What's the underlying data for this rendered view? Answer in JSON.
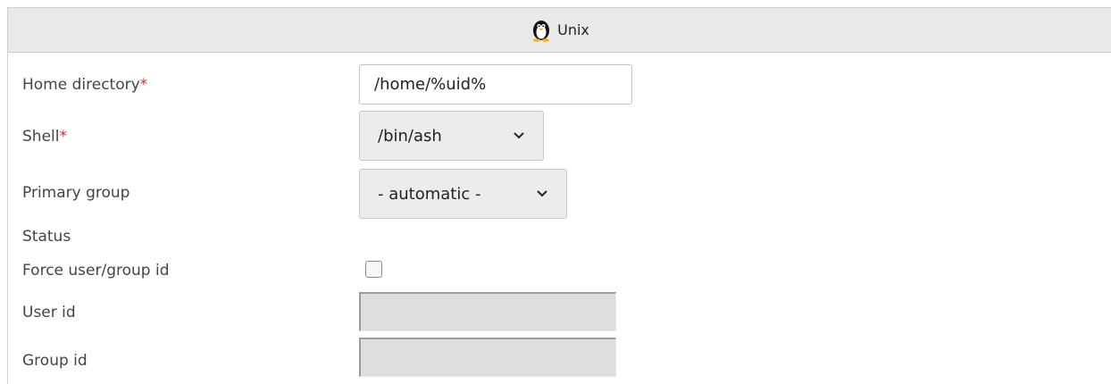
{
  "panel": {
    "title": "Unix",
    "icon": "tux-penguin-icon"
  },
  "fields": {
    "home_directory": {
      "label": "Home directory",
      "required_mark": "*",
      "value": "/home/%uid%"
    },
    "shell": {
      "label": "Shell",
      "required_mark": "*",
      "value": "/bin/ash"
    },
    "primary_group": {
      "label": "Primary group",
      "value": "- automatic -"
    },
    "status": {
      "label": "Status"
    },
    "force_id": {
      "label": "Force user/group id",
      "checked": false
    },
    "user_id": {
      "label": "User id",
      "value": ""
    },
    "group_id": {
      "label": "Group id",
      "value": ""
    }
  },
  "colors": {
    "required": "#d32f2f",
    "header_bg": "#e9e9e9",
    "disabled_bg": "#dedede"
  }
}
